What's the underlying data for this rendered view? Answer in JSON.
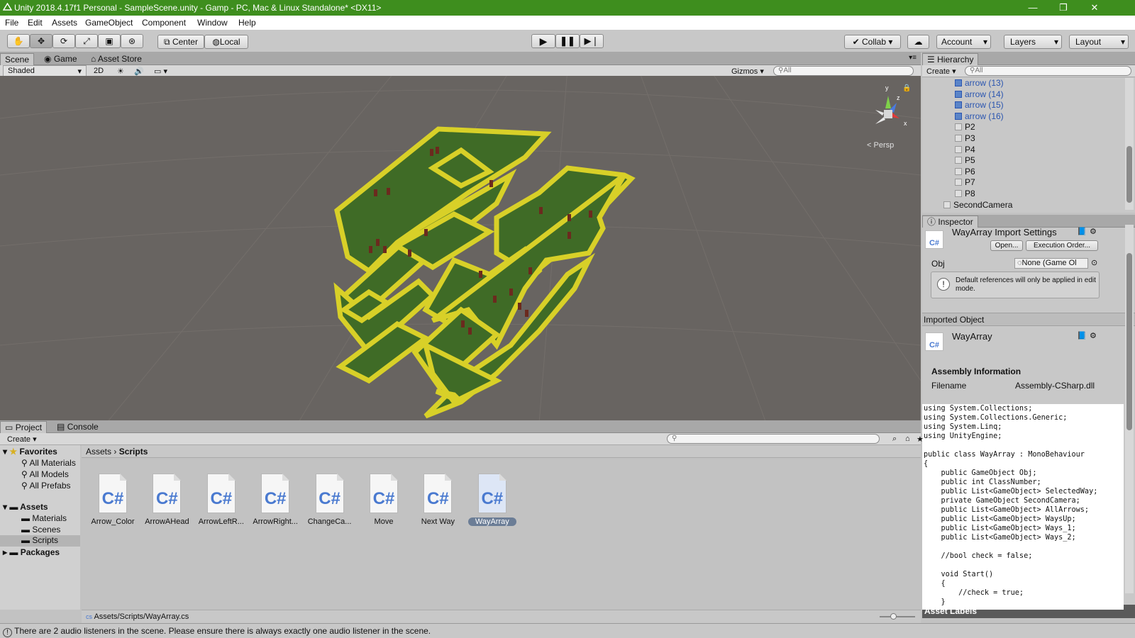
{
  "window": {
    "title": "Unity 2018.4.17f1 Personal - SampleScene.unity - Gamp - PC, Mac & Linux Standalone* <DX11>",
    "controls": [
      "—",
      "❐",
      "✕"
    ]
  },
  "menu": [
    "File",
    "Edit",
    "Assets",
    "GameObject",
    "Component",
    "Window",
    "Help"
  ],
  "toolbar": {
    "pivot": "Center",
    "space": "Local",
    "collab": "Collab",
    "account": "Account",
    "layers": "Layers",
    "layout": "Layout"
  },
  "scene_tabs": [
    "Scene",
    "Game",
    "Asset Store"
  ],
  "scene_bar": {
    "shading": "Shaded",
    "mode": "2D",
    "gizmos": "Gizmos",
    "search_placeholder": "All"
  },
  "gizmo": {
    "y": "y",
    "z": "z",
    "x": "x",
    "projection": "Persp"
  },
  "hierarchy": {
    "title": "Hierarchy",
    "create": "Create",
    "search_placeholder": "All",
    "items": [
      {
        "label": "arrow (13)",
        "prefab": true
      },
      {
        "label": "arrow (14)",
        "prefab": true
      },
      {
        "label": "arrow (15)",
        "prefab": true
      },
      {
        "label": "arrow (16)",
        "prefab": true
      },
      {
        "label": "P2",
        "prefab": false
      },
      {
        "label": "P3",
        "prefab": false
      },
      {
        "label": "P4",
        "prefab": false
      },
      {
        "label": "P5",
        "prefab": false
      },
      {
        "label": "P6",
        "prefab": false
      },
      {
        "label": "P7",
        "prefab": false
      },
      {
        "label": "P8",
        "prefab": false
      },
      {
        "label": "SecondCamera",
        "prefab": false
      }
    ]
  },
  "inspector": {
    "title": "Inspector",
    "header": "WayArray Import Settings",
    "cs_icon": "C#",
    "open_button": "Open...",
    "exec_order_button": "Execution Order...",
    "field_label": "Obj",
    "field_value": "None (Game Ol",
    "help_text": "Default references will only be applied in edit mode.",
    "imported_object": "Imported Object",
    "object_name": "WayArray",
    "assembly_info": "Assembly Information",
    "filename_label": "Filename",
    "filename_value": "Assembly-CSharp.dll",
    "code": "using System.Collections;\nusing System.Collections.Generic;\nusing System.Linq;\nusing UnityEngine;\n\npublic class WayArray : MonoBehaviour\n{\n    public GameObject Obj;\n    public int ClassNumber;\n    public List<GameObject> SelectedWay;\n    private GameObject SecondCamera;\n    public List<GameObject> AllArrows;\n    public List<GameObject> WaysUp;\n    public List<GameObject> Ways_1;\n    public List<GameObject> Ways_2;\n\n    //bool check = false;\n\n    void Start()\n    {\n        //check = true;\n    }",
    "asset_labels": "Asset Labels"
  },
  "project": {
    "tabs": [
      "Project",
      "Console"
    ],
    "create": "Create",
    "favorites_label": "Favorites",
    "favorites": [
      "All Materials",
      "All Models",
      "All Prefabs"
    ],
    "assets_label": "Assets",
    "asset_folders": [
      "Materials",
      "Scenes",
      "Scripts"
    ],
    "packages_label": "Packages",
    "breadcrumb": [
      "Assets",
      "Scripts"
    ],
    "files": [
      "Arrow_Color",
      "ArrowAHead",
      "ArrowLeftR...",
      "ArrowRight...",
      "ChangeCa...",
      "Move",
      "Next Way",
      "WayArray"
    ],
    "file_icon": "C#",
    "selected_file": "WayArray",
    "path": "Assets/Scripts/WayArray.cs"
  },
  "status": {
    "message": "There are 2 audio listeners in the scene. Please ensure there is always exactly one audio listener in the scene."
  },
  "colors": {
    "title_bar": "#3e8e1e",
    "scene_bg": "#686461",
    "maze_fill": "#3f6b26",
    "maze_wall": "#d8d028",
    "prefab_text": "#2a55b0"
  }
}
